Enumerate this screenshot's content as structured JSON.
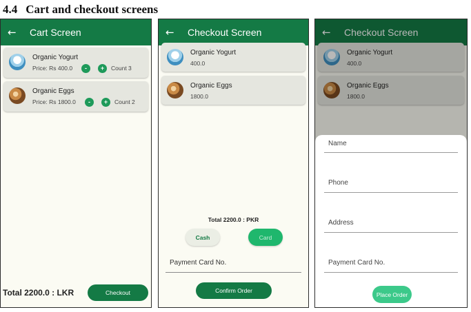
{
  "heading": {
    "number": "4.4",
    "text": "Cart and checkout screens"
  },
  "back_icon": "arrow-left-icon",
  "cart_screen": {
    "title": "Cart Screen",
    "items": [
      {
        "name": "Organic Yogurt",
        "price": "Price: Rs 400.0",
        "minus": "-",
        "plus": "+",
        "count": "Count 3",
        "image": "yogurt-thumbnail"
      },
      {
        "name": "Organic Eggs",
        "price": "Price: Rs 1800.0",
        "minus": "-",
        "plus": "+",
        "count": "Count 2",
        "image": "eggs-thumbnail"
      }
    ],
    "total": "Total 2200.0 : LKR",
    "checkout_label": "Checkout"
  },
  "checkout_screen": {
    "title": "Checkout Screen",
    "items": [
      {
        "name": "Organic Yogurt",
        "price": "400.0"
      },
      {
        "name": "Organic Eggs",
        "price": "1800.0"
      }
    ],
    "total": "Total 2200.0 : PKR",
    "cash_label": "Cash",
    "card_label": "Card",
    "selected_method": "Card",
    "card_field_label": "Payment Card No.",
    "confirm_label": "Confirm Order"
  },
  "order_sheet_screen": {
    "title": "Checkout Screen",
    "items": [
      {
        "name": "Organic Yogurt",
        "price": "400.0"
      },
      {
        "name": "Organic Eggs",
        "price": "1800.0"
      }
    ],
    "form": {
      "name_label": "Name",
      "phone_label": "Phone",
      "address_label": "Address",
      "card_label": "Payment Card No."
    },
    "place_order_label": "Place Order"
  },
  "colors": {
    "primary": "#147a45",
    "accent": "#1fb76d",
    "button_light": "#3cc98a",
    "card_bg": "#e5e6df",
    "screen_bg": "#fbfbf3"
  }
}
